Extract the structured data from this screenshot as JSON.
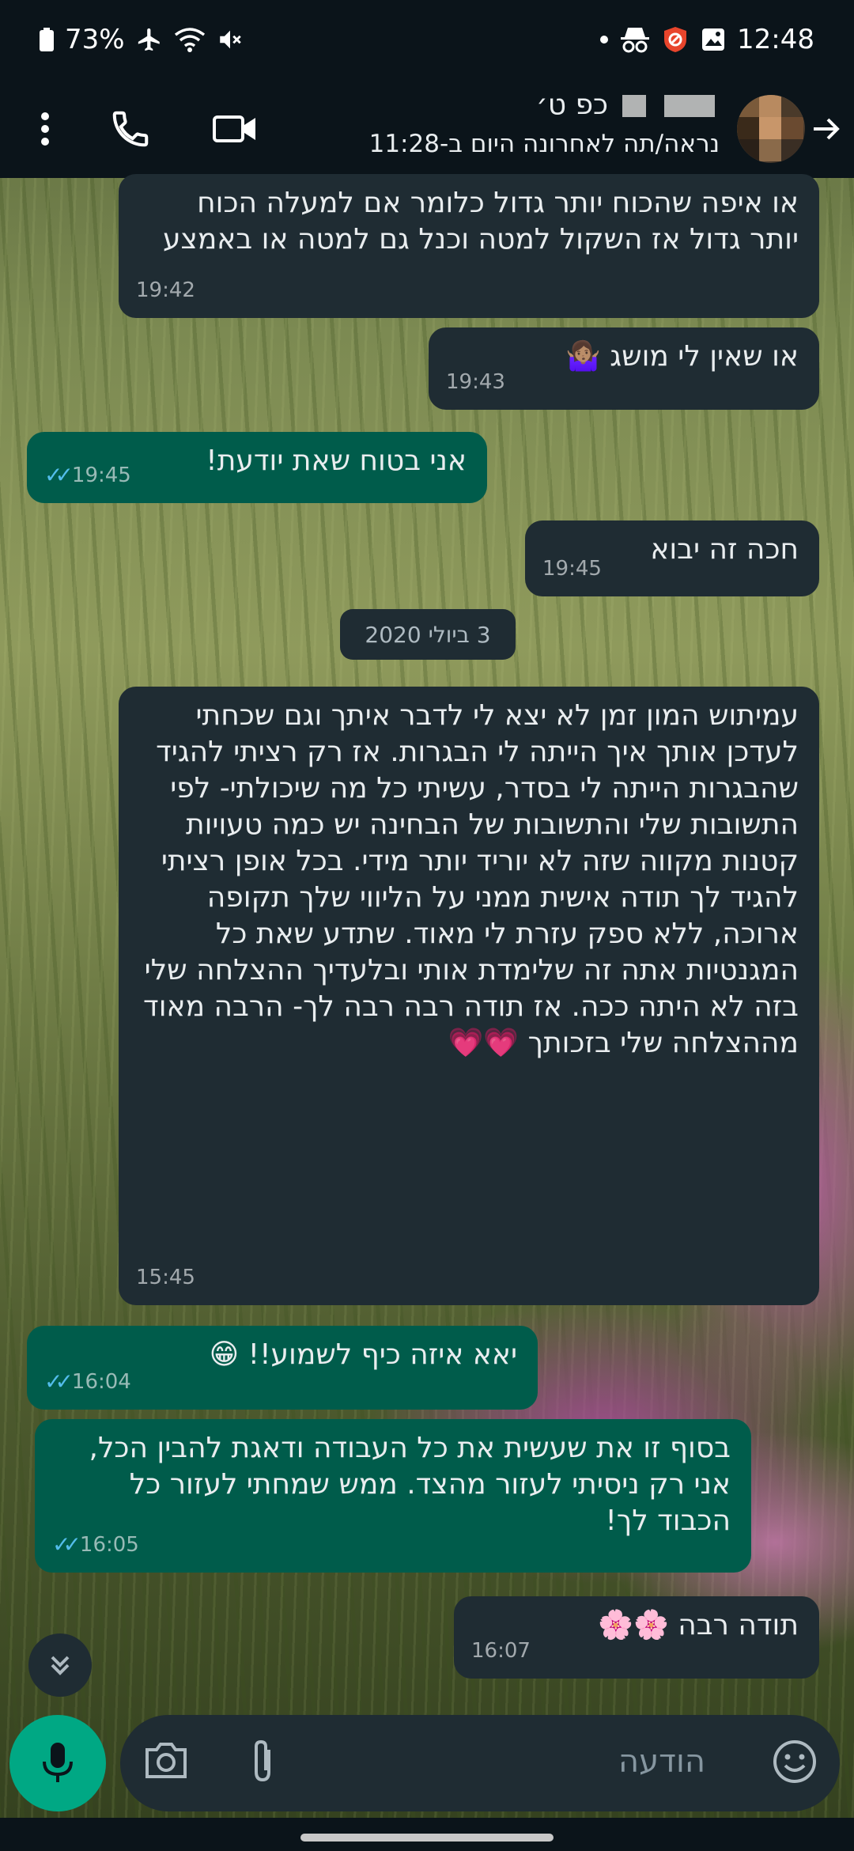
{
  "status_bar": {
    "battery": "73%",
    "time": "12:48"
  },
  "header": {
    "contact_name": "כפ ט׳",
    "last_seen": "נראה/תה לאחרונה היום ב-11:28"
  },
  "messages": [
    {
      "dir": "in",
      "text": "או איפה שהכוח יותר גדול כלומר אם למעלה הכוח יותר גדול אז השקול למטה וכנל גם למטה או באמצע",
      "time": "19:42"
    },
    {
      "dir": "in",
      "text": "או שאין לי מושג 🤷🏽‍♀️",
      "time": "19:43"
    },
    {
      "dir": "out",
      "text": "אני בטוח שאת יודעת!",
      "time": "19:45"
    },
    {
      "dir": "in",
      "text": "חכה זה יבוא",
      "time": "19:45"
    },
    {
      "dir": "in",
      "text": "עמיתוש המון זמן לא יצא לי לדבר איתך וגם שכחתי לעדכן אותך איך הייתה לי הבגרות. אז רק רציתי להגיד שהבגרות הייתה לי בסדר, עשיתי כל מה שיכולתי- לפי התשובות שלי והתשובות של הבחינה יש כמה טעויות קטנות מקווה שזה לא יוריד יותר מידי. בכל אופן רציתי להגיד לך תודה אישית ממני על הליווי שלך תקופה ארוכה, ללא ספק עזרת לי מאוד. שתדע שאת כל המגנטיות אתה זה שלימדת אותי ובלעדיך ההצלחה שלי בזה לא היתה ככה. אז תודה רבה רבה לך- הרבה מאוד מההצלחה שלי בזכותך 💗💗",
      "time": "15:45"
    },
    {
      "dir": "out",
      "text": "יאא איזה כיף לשמוע!! 😁",
      "time": "16:04"
    },
    {
      "dir": "out",
      "text": "בסוף זו את שעשית את כל העבודה ודאגת להבין הכל, אני רק ניסיתי לעזור מהצד. ממש שמחתי לעזור כל הכבוד לך!",
      "time": "16:05"
    },
    {
      "dir": "in",
      "text": "תודה רבה 🌸🌸",
      "time": "16:07"
    }
  ],
  "date_divider": "3 ביולי 2020",
  "composer": {
    "placeholder": "הודעה"
  },
  "colors": {
    "incoming_bubble": "#1f2c33",
    "outgoing_bubble": "#005c4b",
    "accent": "#00a884",
    "read_ticks": "#53bdeb"
  }
}
